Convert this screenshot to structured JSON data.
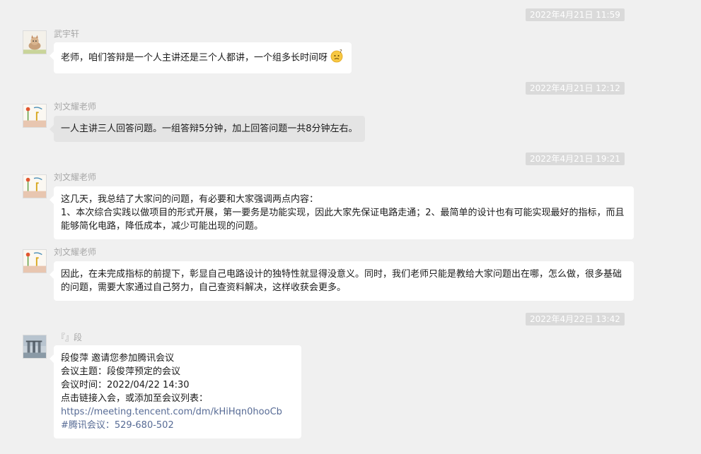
{
  "messages": [
    {
      "timestamp": "2022年4月21日 11:59",
      "sender": "武宇轩",
      "lines": [
        "老师，咱们答辩是一个人主讲还是三个人都讲，一个组多长时间呀"
      ],
      "emoji": "thinking-emoji"
    },
    {
      "timestamp": "2022年4月21日 12:12",
      "sender": "刘文耀老师",
      "lines": [
        "一人主讲三人回答问题。一组答辩5分钟，加上回答问题一共8分钟左右。"
      ]
    },
    {
      "timestamp": "2022年4月21日 19:21",
      "sender": "刘文耀老师",
      "lines": [
        "这几天，我总结了大家问的问题，有必要和大家强调两点内容：",
        "1、本次综合实践以做项目的形式开展，第一要务是功能实现，因此大家先保证电路走通；2、最简单的设计也有可能实现最好的指标，而且能够简化电路，降低成本，减少可能出现的问题。"
      ]
    },
    {
      "sender": "刘文耀老师",
      "lines": [
        "因此，在未完成指标的前提下，彰显自己电路设计的独特性就显得没意义。同时，我们老师只能是教给大家问题出在哪，怎么做，很多基础的问题，需要大家通过自己努力，自己查资料解决，这样收获会更多。"
      ]
    },
    {
      "timestamp": "2022年4月22日 13:42",
      "sender": "『』段",
      "lines": [
        "段俊萍 邀请您参加腾讯会议",
        "会议主题：段俊萍预定的会议",
        "会议时间：2022/04/22 14:30",
        "点击链接入会，或添加至会议列表："
      ],
      "link": "https://meeting.tencent.com/dm/kHiHqn0hooCb",
      "meeting_id": "#腾讯会议：529-680-502"
    }
  ],
  "colors": {
    "background": "#f0f0f0",
    "bubble": "#ffffff",
    "bubble_highlight": "#e4e4e4",
    "timestamp_bg": "#dadada",
    "link": "#576b95"
  }
}
